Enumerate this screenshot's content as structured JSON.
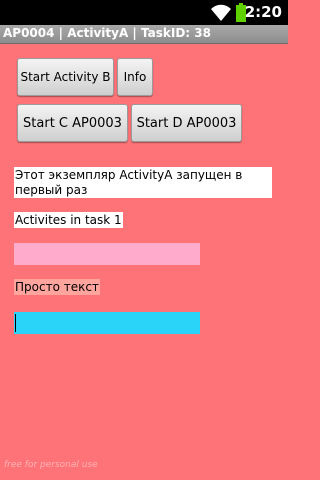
{
  "status_bar": {
    "time": "2:20"
  },
  "title": "AP0004 | ActivityA | TaskID: 38",
  "buttons": {
    "start_b": "Start Activity B",
    "info": "Info",
    "start_c": "Start C AP0003",
    "start_d": "Start D AP0003"
  },
  "message": "Этот экземпляр ActivityA запущен в первый раз",
  "activities_label": "Activites in task 1",
  "plain_text": "Просто текст",
  "input": {
    "value": ""
  },
  "watermark": "free for personal use",
  "colors": {
    "background": "#fe7377",
    "pink_bar": "#ffaccc",
    "plain_text_bg": "#ffa59e",
    "input_bg": "#2ad4f8",
    "battery": "#5fd100"
  }
}
